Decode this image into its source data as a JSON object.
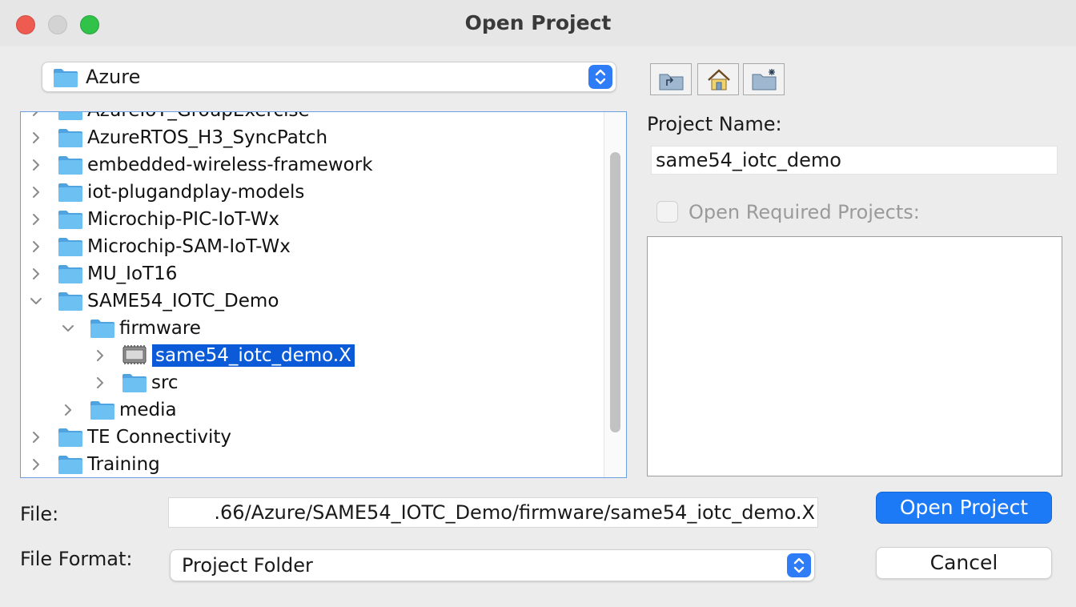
{
  "window": {
    "title": "Open Project"
  },
  "location": {
    "selected": "Azure"
  },
  "toolbar": {
    "icons": [
      "up-folder-icon",
      "home-icon",
      "new-folder-icon"
    ]
  },
  "tree": {
    "items": [
      {
        "label": "AzureIoT_GroupExercise",
        "level": 0,
        "expanded": false,
        "icon": "folder-icon",
        "selected": false
      },
      {
        "label": "AzureRTOS_H3_SyncPatch",
        "level": 0,
        "expanded": false,
        "icon": "folder-icon",
        "selected": false
      },
      {
        "label": "embedded-wireless-framework",
        "level": 0,
        "expanded": false,
        "icon": "folder-icon",
        "selected": false
      },
      {
        "label": "iot-plugandplay-models",
        "level": 0,
        "expanded": false,
        "icon": "folder-icon",
        "selected": false
      },
      {
        "label": "Microchip-PIC-IoT-Wx",
        "level": 0,
        "expanded": false,
        "icon": "folder-icon",
        "selected": false
      },
      {
        "label": "Microchip-SAM-IoT-Wx",
        "level": 0,
        "expanded": false,
        "icon": "folder-icon",
        "selected": false
      },
      {
        "label": "MU_IoT16",
        "level": 0,
        "expanded": false,
        "icon": "folder-icon",
        "selected": false
      },
      {
        "label": "SAME54_IOTC_Demo",
        "level": 0,
        "expanded": true,
        "icon": "folder-icon",
        "selected": false
      },
      {
        "label": "firmware",
        "level": 1,
        "expanded": true,
        "icon": "folder-icon",
        "selected": false
      },
      {
        "label": "same54_iotc_demo.X",
        "level": 2,
        "expanded": false,
        "icon": "chip-project-icon",
        "selected": true
      },
      {
        "label": "src",
        "level": 2,
        "expanded": false,
        "icon": "folder-icon",
        "selected": false
      },
      {
        "label": "media",
        "level": 1,
        "expanded": false,
        "icon": "folder-icon",
        "selected": false
      },
      {
        "label": "TE Connectivity",
        "level": 0,
        "expanded": false,
        "icon": "folder-icon",
        "selected": false
      },
      {
        "label": "Training",
        "level": 0,
        "expanded": false,
        "icon": "folder-icon",
        "selected": false
      }
    ]
  },
  "project": {
    "name_label": "Project Name:",
    "name_value": "same54_iotc_demo",
    "required_label": "Open Required Projects:",
    "required_checked": false
  },
  "file": {
    "label": "File:",
    "value": ".66/Azure/SAME54_IOTC_Demo/firmware/same54_iotc_demo.X"
  },
  "format": {
    "label": "File Format:",
    "selected": "Project Folder"
  },
  "buttons": {
    "open": "Open Project",
    "cancel": "Cancel"
  },
  "colors": {
    "accent": "#1d7af6",
    "selection": "#0b5bd8",
    "folder": "#5ab4ec"
  }
}
